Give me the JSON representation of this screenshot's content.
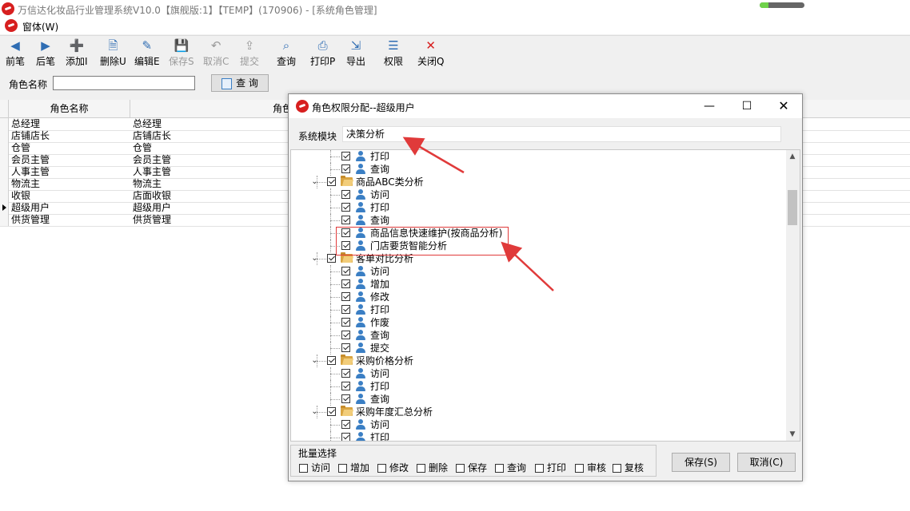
{
  "window": {
    "title": "万信达化妆品行业管理系统V10.0【旗舰版:1】【TEMP】(170906) - [系统角色管理]",
    "progress_fraction": 0.2
  },
  "menu": {
    "window_menu": "窗体(W)"
  },
  "toolbar": {
    "buttons": [
      {
        "label": "前笔",
        "icon": "arrow-left-icon",
        "enabled": true
      },
      {
        "label": "后笔",
        "icon": "arrow-right-icon",
        "enabled": true
      },
      {
        "label": "添加I",
        "icon": "add-document-icon",
        "enabled": true
      },
      {
        "label": "删除U",
        "icon": "delete-document-icon",
        "enabled": true
      },
      {
        "label": "编辑E",
        "icon": "edit-icon",
        "enabled": true
      },
      {
        "label": "保存S",
        "icon": "save-icon",
        "enabled": false
      },
      {
        "label": "取消C",
        "icon": "undo-icon",
        "enabled": false
      },
      {
        "label": "提交",
        "icon": "submit-icon",
        "enabled": false
      },
      {
        "label": "查询",
        "icon": "query-icon",
        "enabled": true
      },
      {
        "label": "打印P",
        "icon": "printer-icon",
        "enabled": true
      },
      {
        "label": "导出",
        "icon": "export-icon",
        "enabled": true
      },
      {
        "label": "权限",
        "icon": "permission-icon",
        "enabled": true
      },
      {
        "label": "关闭Q",
        "icon": "close-icon",
        "enabled": true
      }
    ]
  },
  "search": {
    "label": "角色名称",
    "value": "",
    "button": "查 询"
  },
  "grid": {
    "headers": [
      "角色名称",
      "角色"
    ],
    "rows": [
      {
        "name": "总经理",
        "desc": "总经理",
        "current": false
      },
      {
        "name": "店铺店长",
        "desc": "店铺店长",
        "current": false
      },
      {
        "name": "仓管",
        "desc": "仓管",
        "current": false
      },
      {
        "name": "会员主管",
        "desc": "会员主管",
        "current": false
      },
      {
        "name": "人事主管",
        "desc": "人事主管",
        "current": false
      },
      {
        "name": "物流主",
        "desc": "物流主",
        "current": false
      },
      {
        "name": "收银",
        "desc": "店面收银",
        "current": false
      },
      {
        "name": "超级用户",
        "desc": "超级用户",
        "current": true
      },
      {
        "name": "供货管理",
        "desc": "供货管理",
        "current": false
      }
    ]
  },
  "dialog": {
    "title": "角色权限分配--超级用户",
    "module_label": "系统模块",
    "module_value": "决策分析",
    "tree": [
      {
        "level": 2,
        "label": "打印",
        "type": "leaf",
        "checked": true
      },
      {
        "level": 2,
        "label": "查询",
        "type": "leaf",
        "checked": true
      },
      {
        "level": 1,
        "label": "商品ABC类分析",
        "type": "folder",
        "checked": true
      },
      {
        "level": 2,
        "label": "访问",
        "type": "leaf",
        "checked": true
      },
      {
        "level": 2,
        "label": "打印",
        "type": "leaf",
        "checked": true
      },
      {
        "level": 2,
        "label": "查询",
        "type": "leaf",
        "checked": true
      },
      {
        "level": 2,
        "label": "商品信息快速维护(按商品分析)",
        "type": "leaf",
        "checked": true
      },
      {
        "level": 2,
        "label": "门店要货智能分析",
        "type": "leaf",
        "checked": true
      },
      {
        "level": 1,
        "label": "客单对比分析",
        "type": "folder",
        "checked": true
      },
      {
        "level": 2,
        "label": "访问",
        "type": "leaf",
        "checked": true
      },
      {
        "level": 2,
        "label": "增加",
        "type": "leaf",
        "checked": true
      },
      {
        "level": 2,
        "label": "修改",
        "type": "leaf",
        "checked": true
      },
      {
        "level": 2,
        "label": "打印",
        "type": "leaf",
        "checked": true
      },
      {
        "level": 2,
        "label": "作废",
        "type": "leaf",
        "checked": true
      },
      {
        "level": 2,
        "label": "查询",
        "type": "leaf",
        "checked": true
      },
      {
        "level": 2,
        "label": "提交",
        "type": "leaf",
        "checked": true
      },
      {
        "level": 1,
        "label": "采购价格分析",
        "type": "folder",
        "checked": true
      },
      {
        "level": 2,
        "label": "访问",
        "type": "leaf",
        "checked": true
      },
      {
        "level": 2,
        "label": "打印",
        "type": "leaf",
        "checked": true
      },
      {
        "level": 2,
        "label": "查询",
        "type": "leaf",
        "checked": true
      },
      {
        "level": 1,
        "label": "采购年度汇总分析",
        "type": "folder",
        "checked": true
      },
      {
        "level": 2,
        "label": "访问",
        "type": "leaf",
        "checked": true
      },
      {
        "level": 2,
        "label": "打印",
        "type": "leaf",
        "checked": true
      }
    ],
    "batch": {
      "title": "批量选择",
      "items": [
        "访问",
        "增加",
        "修改",
        "删除",
        "保存",
        "查询",
        "打印",
        "审核",
        "复核"
      ]
    },
    "save_button": "保存(S)",
    "cancel_button": "取消(C)"
  },
  "colors": {
    "annotation_red": "#e03a3a",
    "user_icon_blue": "#3b7fc4",
    "app_logo_red": "#d71f1f"
  }
}
